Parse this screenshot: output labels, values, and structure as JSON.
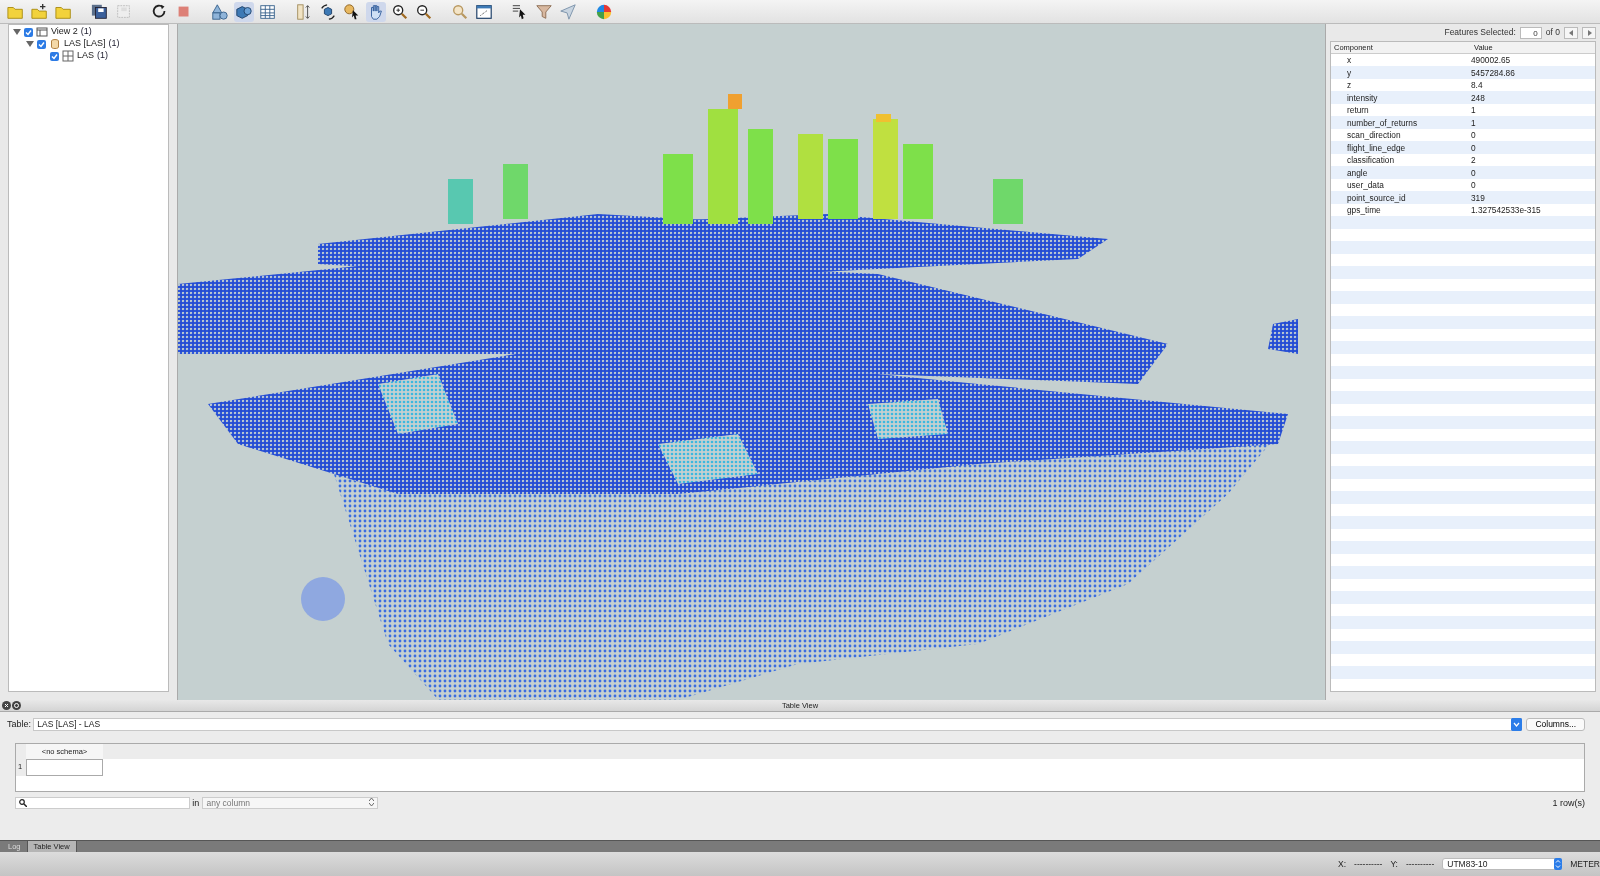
{
  "toolbar": [
    {
      "kind": "folder",
      "selected": false
    },
    {
      "kind": "folder-add",
      "selected": false
    },
    {
      "kind": "folder",
      "selected": false
    },
    {
      "kind": "save",
      "selected": false
    },
    {
      "kind": "save-disabled",
      "selected": false
    },
    {
      "kind": "refresh",
      "selected": false
    },
    {
      "kind": "stop",
      "selected": false
    },
    {
      "kind": "shapes",
      "selected": false
    },
    {
      "kind": "cube-sphere",
      "selected": true
    },
    {
      "kind": "grid",
      "selected": false
    },
    {
      "kind": "ruler",
      "selected": false
    },
    {
      "kind": "rotate",
      "selected": false
    },
    {
      "kind": "info-pointer",
      "selected": false
    },
    {
      "kind": "hand",
      "selected": true
    },
    {
      "kind": "zoom-in",
      "selected": false
    },
    {
      "kind": "zoom-out",
      "selected": false
    },
    {
      "kind": "info-search",
      "selected": false
    },
    {
      "kind": "window",
      "selected": false
    },
    {
      "kind": "select",
      "selected": false
    },
    {
      "kind": "filter",
      "selected": false
    },
    {
      "kind": "send",
      "selected": false
    },
    {
      "kind": "color-wheel",
      "selected": false
    }
  ],
  "layers": [
    {
      "kind": "view",
      "label": "View 2",
      "count": "(1)",
      "checked": true,
      "expanded": true,
      "children": [
        {
          "kind": "database",
          "label": "LAS [LAS]",
          "count": "(1)",
          "checked": true,
          "expanded": true,
          "children": [
            {
              "kind": "table",
              "label": "LAS",
              "count": "(1)",
              "checked": true
            }
          ]
        }
      ]
    }
  ],
  "selection": {
    "label": "Features Selected:",
    "count": "0",
    "of": "of 0"
  },
  "properties": {
    "columns": [
      "Component",
      "Value"
    ],
    "rows": [
      {
        "component": "x",
        "value": "490002.65"
      },
      {
        "component": "y",
        "value": "5457284.86"
      },
      {
        "component": "z",
        "value": "8.4"
      },
      {
        "component": "intensity",
        "value": "248"
      },
      {
        "component": "return",
        "value": "1"
      },
      {
        "component": "number_of_returns",
        "value": "1"
      },
      {
        "component": "scan_direction",
        "value": "0"
      },
      {
        "component": "flight_line_edge",
        "value": "0"
      },
      {
        "component": "classification",
        "value": "2"
      },
      {
        "component": "angle",
        "value": "0"
      },
      {
        "component": "user_data",
        "value": "0"
      },
      {
        "component": "point_source_id",
        "value": "319"
      },
      {
        "component": "gps_time",
        "value": "1.327542533e-315"
      }
    ]
  },
  "table_view": {
    "title": "Table View",
    "table_label": "Table:",
    "table_value": "LAS [LAS] - LAS",
    "columns_button": "Columns...",
    "grid_columns": [
      "<no schema>"
    ],
    "grid_rows": [
      {
        "number": "1",
        "cells": [
          ""
        ]
      }
    ],
    "search_in": "in",
    "search_column": "any column",
    "row_count": "1 row(s)"
  },
  "tabs": [
    {
      "label": "Log",
      "selected": false
    },
    {
      "label": "Table View",
      "selected": true
    }
  ],
  "status_bar": {
    "x_label": "X:",
    "x_value": "----------",
    "y_label": "Y:",
    "y_value": "----------",
    "crs": "UTM83-10",
    "unit": "METER"
  }
}
